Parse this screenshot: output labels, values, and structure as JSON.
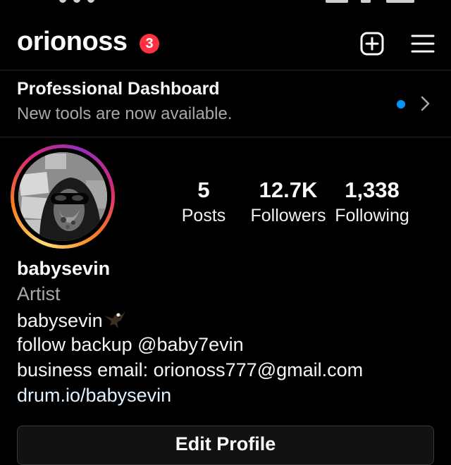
{
  "header": {
    "username": "orionoss",
    "notification_count": "3"
  },
  "dashboard": {
    "title": "Professional Dashboard",
    "subtitle": "New tools are now available."
  },
  "stats": [
    {
      "value": "5",
      "label": "Posts"
    },
    {
      "value": "12.7K",
      "label": "Followers"
    },
    {
      "value": "1,338",
      "label": "Following"
    }
  ],
  "bio": {
    "name": "babysevin",
    "category": "Artist",
    "line1": "babysevin",
    "line2": "follow backup @baby7evin",
    "line3": "business email: orionoss777@gmail.com",
    "link": "drum.io/babysevin"
  },
  "actions": {
    "edit_profile": "Edit Profile"
  },
  "colors": {
    "background": "#000000",
    "badge": "#ff3040",
    "unread_dot": "#0095f6",
    "secondary_text": "#a8a8a8"
  },
  "icons": {
    "create": "plus-square-icon",
    "menu": "hamburger-menu-icon",
    "chevron": "chevron-right-icon",
    "bio_emoji": "eagle-icon"
  }
}
